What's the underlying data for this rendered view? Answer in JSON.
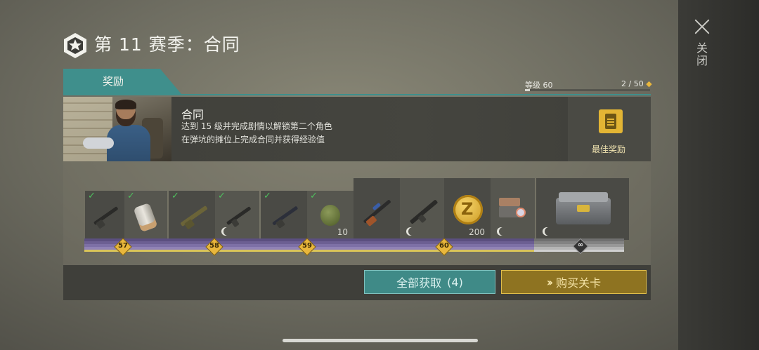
{
  "header": {
    "season_title": "第 11 赛季：合同"
  },
  "close": {
    "label": "关闭"
  },
  "tabs": [
    {
      "label": "奖励"
    }
  ],
  "level": {
    "label": "等级 60",
    "progress": "2 / 50",
    "progress_fraction": 0.04
  },
  "contract": {
    "title": "合同",
    "line1": "达到 15 级并完成剧情以解锁第二个角色",
    "line2": "在弹坑的摊位上完成合同并获得经验值"
  },
  "best_reward": {
    "label": "最佳奖励"
  },
  "rewards": [
    {
      "level": "57",
      "items": [
        {
          "icon": "rifle-icon",
          "claimed": true
        },
        {
          "icon": "silencer-icon",
          "claimed": true
        }
      ]
    },
    {
      "level": "58",
      "items": [
        {
          "icon": "camo-rifle-icon",
          "claimed": true
        },
        {
          "icon": "smg-icon",
          "claimed": true
        }
      ]
    },
    {
      "level": "59",
      "items": [
        {
          "icon": "carbine-icon",
          "claimed": true
        },
        {
          "icon": "grenade-icon",
          "claimed": true,
          "qty": "10"
        }
      ]
    },
    {
      "level": "60",
      "items": [
        {
          "icon": "marksman-rifle-icon"
        },
        {
          "icon": "assault-rifle-icon"
        },
        {
          "icon": "coin-icon",
          "qty": "200"
        },
        {
          "icon": "workbench-icon"
        }
      ]
    },
    {
      "level": "∞",
      "items": [
        {
          "icon": "crate-icon"
        }
      ]
    }
  ],
  "actions": {
    "claim_all": "全部获取",
    "claim_count": "(4)",
    "buy_level": "购买关卡"
  },
  "colors": {
    "teal": "#3f8f8c",
    "gold": "#e9b73c",
    "check": "#4fbf5e"
  }
}
